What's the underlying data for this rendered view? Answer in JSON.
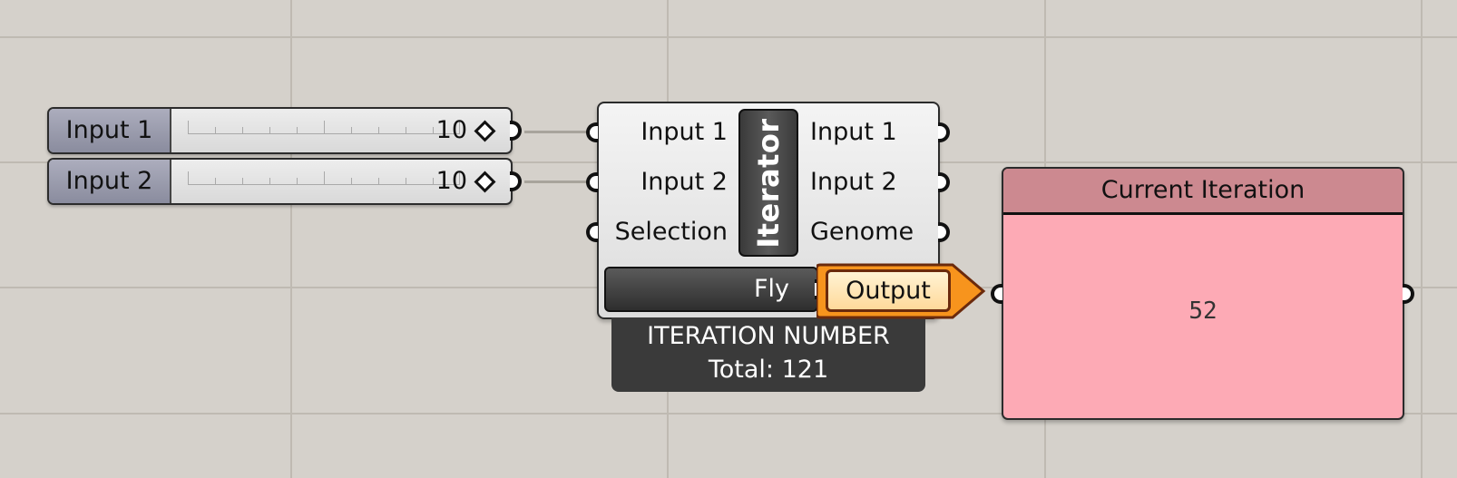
{
  "sliders": [
    {
      "label": "Input 1",
      "value": "10"
    },
    {
      "label": "Input 2",
      "value": "10"
    }
  ],
  "iterator": {
    "title": "Iterator",
    "inputs": [
      "Input 1",
      "Input 2",
      "Selection"
    ],
    "outputs": [
      "Input 1",
      "Input 2",
      "Genome"
    ],
    "fly_label": "Fly",
    "caption_line1": "ITERATION NUMBER",
    "caption_line2": "Total: 121"
  },
  "output_tag": {
    "label": "Output"
  },
  "panel": {
    "title": "Current Iteration",
    "value": "52"
  },
  "colors": {
    "canvas": "#d5d1cb",
    "panel_body": "#fdaab5",
    "panel_header": "#cc8990",
    "output_tag": "#f7941d",
    "slider_label": "#9a9cad"
  }
}
